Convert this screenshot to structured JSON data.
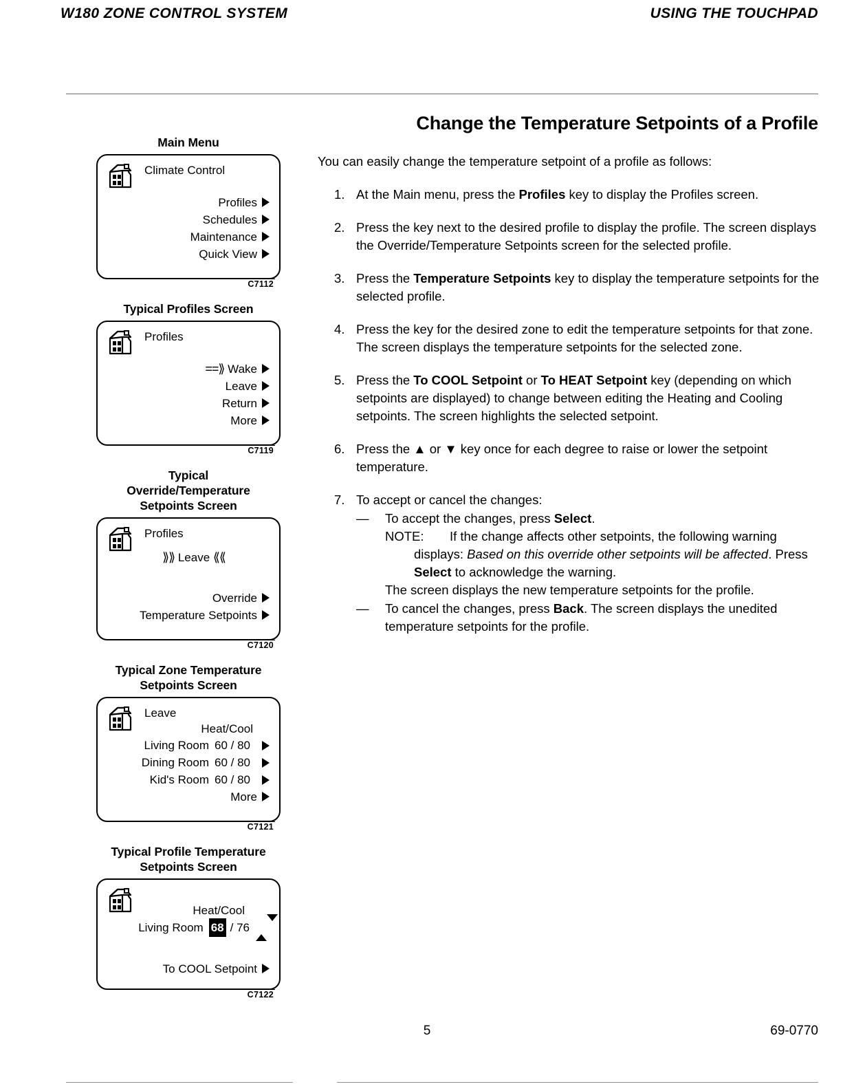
{
  "header": {
    "left": "W180 ZONE CONTROL SYSTEM",
    "right": "USING THE TOUCHPAD"
  },
  "section_title": "Change the Temperature Setpoints of a Profile",
  "figures": [
    {
      "caption": "Main Menu",
      "fig_id": "C7112",
      "screen_title": "Climate Control",
      "rows": [
        "Profiles",
        "Schedules",
        "Maintenance",
        "Quick View"
      ]
    },
    {
      "caption": "Typical Profiles Screen",
      "fig_id": "C7119",
      "screen_title": "Profiles",
      "marker": "==⟫",
      "rows": [
        "Wake",
        "Leave",
        "Return",
        "More"
      ]
    },
    {
      "caption_lines": [
        "Typical",
        "Override/Temperature",
        "Setpoints Screen"
      ],
      "fig_id": "C7120",
      "screen_title": "Profiles",
      "selected_left": "⟫⟫",
      "selected_label": "Leave",
      "selected_right": "⟪⟪",
      "rows": [
        "Override",
        "Temperature Setpoints"
      ]
    },
    {
      "caption_lines": [
        "Typical Zone Temperature",
        "Setpoints Screen"
      ],
      "fig_id": "C7121",
      "screen_title": "Leave",
      "col_header": "Heat/Cool",
      "zones": [
        {
          "name": "Living Room",
          "value": "60 / 80"
        },
        {
          "name": "Dining Room",
          "value": "60 / 80"
        },
        {
          "name": "Kid's Room",
          "value": "60 / 80"
        }
      ],
      "more_row": "More"
    },
    {
      "caption_lines": [
        "Typical Profile Temperature",
        "Setpoints Screen"
      ],
      "fig_id": "C7122",
      "col_header": "Heat/Cool",
      "zone_name": "Living Room",
      "heat_value": "68",
      "cool_value": "/ 76",
      "bottom_row": "To COOL Setpoint"
    }
  ],
  "body": {
    "intro": "You can easily change the temperature setpoint of a profile as follows:",
    "steps": [
      {
        "num": "1.",
        "parts": [
          {
            "t": "At the Main menu, press the "
          },
          {
            "t": "Profiles",
            "b": true
          },
          {
            "t": " key to display the Profiles screen."
          }
        ]
      },
      {
        "num": "2.",
        "parts": [
          {
            "t": "Press the key next to the desired profile to display the profile. The screen displays the Override/Temperature Setpoints screen for the selected profile."
          }
        ]
      },
      {
        "num": "3.",
        "parts": [
          {
            "t": "Press the "
          },
          {
            "t": "Temperature Setpoints",
            "b": true
          },
          {
            "t": " key to display the temperature setpoints for the selected profile."
          }
        ]
      },
      {
        "num": "4.",
        "parts": [
          {
            "t": "Press the key for the desired zone to edit the temperature setpoints for that zone. The screen displays the temperature setpoints for the selected zone."
          }
        ]
      },
      {
        "num": "5.",
        "parts": [
          {
            "t": "Press the "
          },
          {
            "t": "To COOL Setpoint",
            "b": true
          },
          {
            "t": " or "
          },
          {
            "t": "To HEAT Setpoint",
            "b": true
          },
          {
            "t": " key (depending on which setpoints are displayed) to change between editing the Heating and Cooling setpoints. The screen highlights the selected setpoint."
          }
        ]
      },
      {
        "num": "6.",
        "parts": [
          {
            "t": "Press the ▲ or ▼ key once for each degree to raise or lower the setpoint temperature."
          }
        ]
      }
    ],
    "step7": {
      "num": "7.",
      "lead": "To accept or cancel the changes:",
      "dash": "—",
      "accept_parts": [
        {
          "t": "To accept the changes, press "
        },
        {
          "t": "Select",
          "b": true
        },
        {
          "t": "."
        }
      ],
      "note_label": "NOTE:",
      "note_parts": [
        {
          "t": "If the change affects other setpoints, the following warning displays: "
        },
        {
          "t": "Based on this override other setpoints will be affected",
          "i": true
        },
        {
          "t": ". Press "
        },
        {
          "t": "Select",
          "b": true
        },
        {
          "t": " to acknowledge the warning."
        }
      ],
      "after_note": "The screen displays the new temperature setpoints for the profile.",
      "cancel_parts": [
        {
          "t": "To cancel the changes, press "
        },
        {
          "t": "Back",
          "b": true
        },
        {
          "t": ". The screen displays the unedited temperature setpoints for the profile."
        }
      ]
    }
  },
  "footer": {
    "page": "5",
    "code": "69-0770"
  }
}
